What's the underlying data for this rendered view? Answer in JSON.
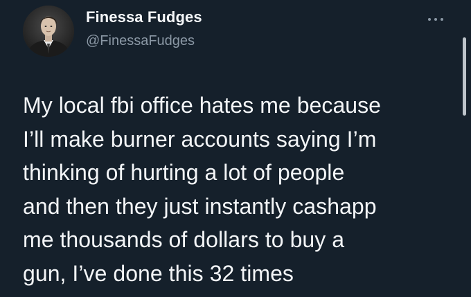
{
  "author": {
    "display_name": "Finessa Fudges",
    "handle": "@FinessaFudges",
    "avatar_icon": "profile-photo"
  },
  "tweet": {
    "text": "My local fbi office hates me because\nI’ll make burner accounts saying I’m\nthinking of hurting a lot of people\nand then they just instantly cashapp\nme thousands of dollars to buy a\ngun, I’ve done this 32 times"
  },
  "controls": {
    "more_icon": "more-horizontal-icon"
  },
  "colors": {
    "background": "#15202b",
    "text_primary": "#f3f5f7",
    "text_secondary": "#8b98a5"
  }
}
